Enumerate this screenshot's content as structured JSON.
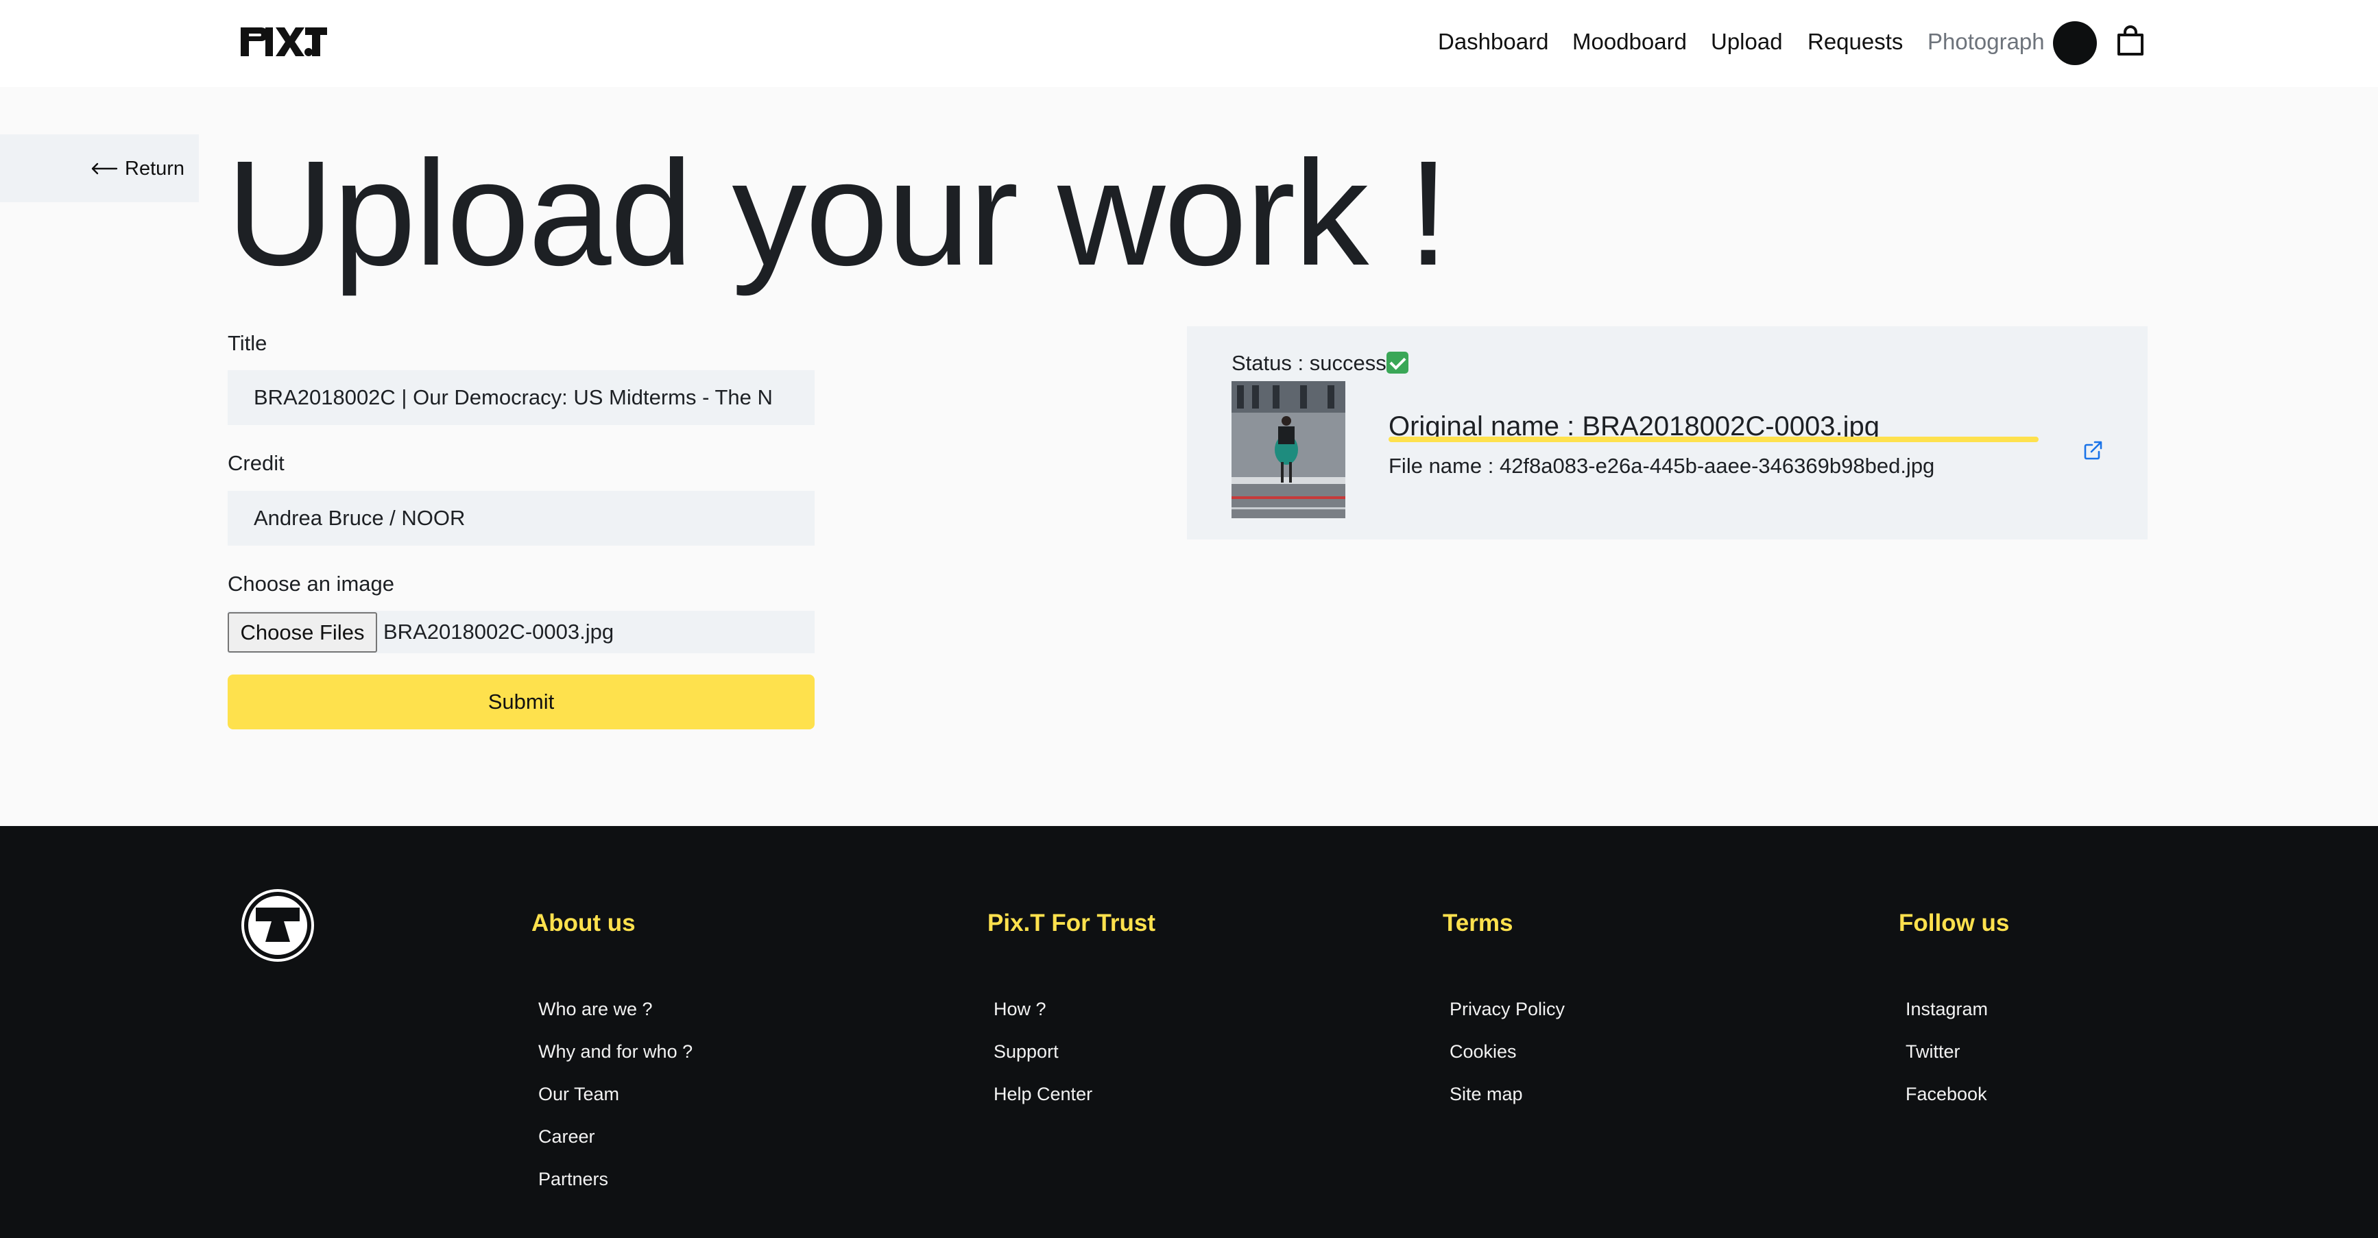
{
  "header": {
    "logo_text": "PIX.T",
    "nav": [
      {
        "label": "Dashboard",
        "active": false
      },
      {
        "label": "Moodboard",
        "active": false
      },
      {
        "label": "Upload",
        "active": false
      },
      {
        "label": "Requests",
        "active": false
      },
      {
        "label": "Photograph",
        "active": false,
        "muted": true
      }
    ],
    "avatar_color": "#0d0f10",
    "cart_icon": "shopping-bag-icon"
  },
  "return_link": {
    "label": "Return",
    "icon": "arrow-left-icon"
  },
  "page_title": "Upload your work !",
  "form": {
    "title_label": "Title",
    "title_value": "BRA2018002C | Our Democracy: US Midterms - The N",
    "credit_label": "Credit",
    "credit_value": "Andrea Bruce / NOOR",
    "image_label": "Choose an image",
    "choose_files_label": "Choose Files",
    "selected_file": "BRA2018002C-0003.jpg",
    "submit_label": "Submit"
  },
  "upload_status": {
    "status_text": "Status : success",
    "status_icon": "check-mark-button-icon",
    "original_name": "Original name : BRA2018002C-0003.jpg",
    "file_name": "File name : 42f8a083-e26a-445b-aaee-346369b98bed.jpg",
    "open_icon": "external-link-icon"
  },
  "footer": {
    "logo_icon": "pixt-t-logo-icon",
    "columns": [
      {
        "title": "About us",
        "links": [
          "Who are we ?",
          "Why and for who ?",
          "Our Team",
          "Career",
          "Partners"
        ]
      },
      {
        "title": "Pix.T For Trust",
        "links": [
          "How ?",
          "Support",
          "Help Center"
        ]
      },
      {
        "title": "Terms",
        "links": [
          "Privacy Policy",
          "Cookies",
          "Site map"
        ]
      },
      {
        "title": "Follow us",
        "links": [
          "Instagram",
          "Twitter",
          "Facebook"
        ]
      }
    ]
  },
  "colors": {
    "accent_yellow": "#fee14d",
    "panel_gray": "#eff2f5",
    "footer_bg": "#0e1012",
    "link_blue": "#1a73e8"
  }
}
